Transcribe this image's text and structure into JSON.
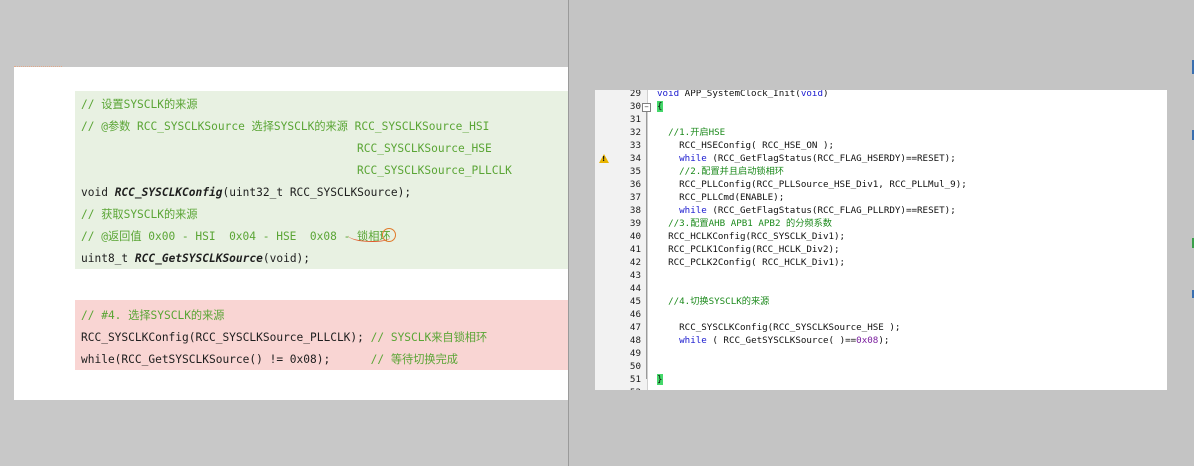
{
  "doc": {
    "green_lines": [
      "// 设置SYSCLK的来源",
      "// @参数 RCC_SYSCLKSource 选择SYSCLK的来源 RCC_SYSCLKSource_HSI",
      "RCC_SYSCLKSource_HSE",
      "RCC_SYSCLKSource_PLLCLK",
      "void ",
      "RCC_SYSCLKConfig",
      "(uint32_t RCC_SYSCLKSource);",
      "// 获取SYSCLK的来源",
      "// @返回值 0x00 - HSI  0x04 - HSE  0x08 - 锁相环",
      "uint8_t ",
      "RCC_GetSYSCLKSource",
      "(void);"
    ],
    "red_lines": [
      "// #4. 选择SYSCLK的来源",
      "RCC_SYSCLKConfig(RCC_SYSCLKSource_PLLCLK); ",
      "// SYSCLK来自锁相环",
      "while(RCC_GetSYSCLKSource() != 0x08);      ",
      "// 等待切换完成"
    ]
  },
  "editor": {
    "lines": [
      {
        "n": "29",
        "parts": [
          {
            "t": "void",
            "c": "k"
          },
          {
            "t": " APP_SystemClock_Init(",
            "c": ""
          },
          {
            "t": "void",
            "c": "k"
          },
          {
            "t": ")",
            "c": ""
          }
        ]
      },
      {
        "n": "30",
        "parts": [
          {
            "t": "{",
            "c": "brace"
          }
        ]
      },
      {
        "n": "31",
        "parts": []
      },
      {
        "n": "32",
        "parts": [
          {
            "t": "  //1.开启HSE",
            "c": "cm"
          }
        ]
      },
      {
        "n": "33",
        "parts": [
          {
            "t": "    RCC_HSEConfig( RCC_HSE_ON );",
            "c": ""
          }
        ]
      },
      {
        "n": "34",
        "parts": [
          {
            "t": "    ",
            "c": ""
          },
          {
            "t": "while",
            "c": "k"
          },
          {
            "t": " (RCC_GetFlagStatus(RCC_FLAG_HSERDY)==RESET);",
            "c": ""
          }
        ]
      },
      {
        "n": "35",
        "parts": [
          {
            "t": "    //2.配置并且启动锁相环",
            "c": "cm"
          }
        ]
      },
      {
        "n": "36",
        "parts": [
          {
            "t": "    RCC_PLLConfig(RCC_PLLSource_HSE_Div1, RCC_PLLMul_9);",
            "c": ""
          }
        ]
      },
      {
        "n": "37",
        "parts": [
          {
            "t": "    RCC_PLLCmd(ENABLE);",
            "c": ""
          }
        ]
      },
      {
        "n": "38",
        "parts": [
          {
            "t": "    ",
            "c": ""
          },
          {
            "t": "while",
            "c": "k"
          },
          {
            "t": " (RCC_GetFlagStatus(RCC_FLAG_PLLRDY)==RESET);",
            "c": ""
          }
        ]
      },
      {
        "n": "39",
        "parts": [
          {
            "t": "  //3.配置AHB APB1 APB2 的分频系数",
            "c": "cm"
          }
        ]
      },
      {
        "n": "40",
        "parts": [
          {
            "t": "  RCC_HCLKConfig(RCC_SYSCLK_Div1);",
            "c": ""
          }
        ]
      },
      {
        "n": "41",
        "parts": [
          {
            "t": "  RCC_PCLK1Config(RCC_HCLK_Div2);",
            "c": ""
          }
        ]
      },
      {
        "n": "42",
        "parts": [
          {
            "t": "  RCC_PCLK2Config( RCC_HCLK_Div1);",
            "c": ""
          }
        ]
      },
      {
        "n": "43",
        "parts": []
      },
      {
        "n": "44",
        "parts": []
      },
      {
        "n": "45",
        "parts": [
          {
            "t": "  //4.切换SYSCLK的来源",
            "c": "cm"
          }
        ]
      },
      {
        "n": "46",
        "parts": []
      },
      {
        "n": "47",
        "parts": [
          {
            "t": "    RCC_SYSCLKConfig(RCC_SYSCLKSource_HSE );",
            "c": ""
          }
        ]
      },
      {
        "n": "48",
        "parts": [
          {
            "t": "    ",
            "c": ""
          },
          {
            "t": "while",
            "c": "k"
          },
          {
            "t": " ( RCC_GetSYSCLKSource( )==",
            "c": ""
          },
          {
            "t": "0x08",
            "c": "nm"
          },
          {
            "t": ");",
            "c": ""
          }
        ]
      },
      {
        "n": "49",
        "parts": []
      },
      {
        "n": "50",
        "parts": []
      },
      {
        "n": "51",
        "parts": [
          {
            "t": "}",
            "c": "brace"
          }
        ]
      },
      {
        "n": "52",
        "parts": []
      }
    ],
    "warning_line": "34",
    "warn_glyph": "!",
    "fold_glyph": "−"
  },
  "colors": {
    "keyword": "#1a1acf",
    "comment": "#1c8a1c",
    "number": "#7a1e9e",
    "brace_highlight": "#44d86a",
    "doc_comment": "#5aa535",
    "warning": "#e8b400"
  },
  "icons": {
    "warning": "warning-icon",
    "fold": "fold-collapse-icon"
  }
}
